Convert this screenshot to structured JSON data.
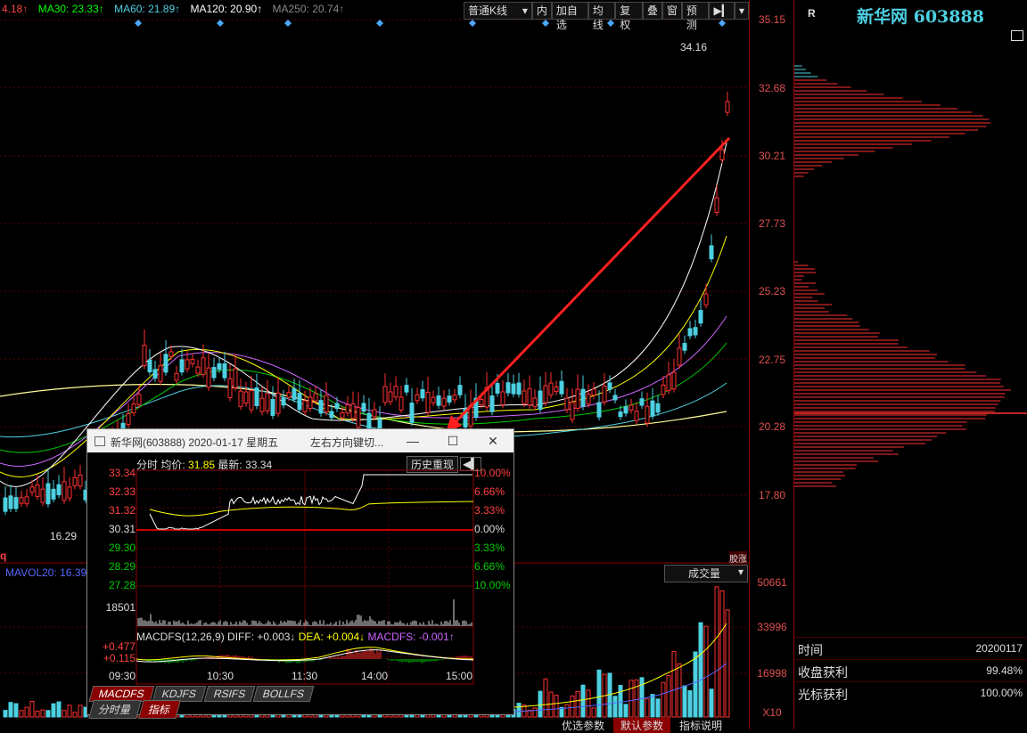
{
  "ma_line": {
    "ma_first": "4.18↑",
    "ma30": "MA30: 23.33↑",
    "ma60": "MA60: 21.89↑",
    "ma120": "MA120: 20.90↑",
    "ma250": "MA250: 20.74↑",
    "colors": {
      "ma_first": "#ff4040",
      "ma30": "#00ff00",
      "ma60": "#4dd0e1",
      "ma120": "#ffffff",
      "ma250": "#888888"
    }
  },
  "toolbar": {
    "kline_type": "普通K线",
    "buttons": [
      "内",
      "加自选",
      "均线",
      "复权",
      "叠",
      "窗",
      "预测"
    ]
  },
  "price_axis": [
    "35.15",
    "32.68",
    "30.21",
    "27.73",
    "25.23",
    "22.75",
    "20.28",
    "17.80"
  ],
  "volume_axis": [
    "50661",
    "33996",
    "16998",
    "X10"
  ],
  "high_label": "34.16",
  "low_label": "16.29",
  "fan_label": "胶涨",
  "volume": {
    "selector": "成交量",
    "mavol": "MAVOL20: 16.39",
    "indicator_char": "q"
  },
  "sidebar": {
    "r_mark": "R",
    "title": "新华网 603888",
    "stats": [
      {
        "key": "时间",
        "value": "20200117"
      },
      {
        "key": "收盘获利",
        "value": "99.48%"
      },
      {
        "key": "光标获利",
        "value": "100.00%"
      }
    ]
  },
  "popup": {
    "title": "新华网(603888)  2020-01-17 星期五",
    "subtitle": "左右方向键切...",
    "head": {
      "label": "分时",
      "avg_label": "均价:",
      "avg": "31.85",
      "last_label": "最新:",
      "last": "33.34"
    },
    "history_btn": "历史重现",
    "left_prices": [
      "33.34",
      "32.33",
      "31.32",
      "30.31",
      "29.30",
      "28.29",
      "27.28"
    ],
    "right_pcts": [
      "10.00%",
      "6.66%",
      "3.33%",
      "0.00%",
      "3.33%",
      "6.66%",
      "10.00%"
    ],
    "vol_label": "18501",
    "macd": {
      "name": "MACDFS(12,26,9)",
      "diff": "DIFF: +0.003↓",
      "dea": "DEA: +0.004↓",
      "macdfs": "MACDFS: -0.001↑",
      "hi": "+0.477",
      "mid": "+0.115"
    },
    "times": [
      "09:30",
      "10:30",
      "11:30",
      "14:00",
      "15:00"
    ],
    "tabs": [
      "MACDFS",
      "KDJFS",
      "RSIFS",
      "BOLLFS"
    ],
    "tabs2": [
      "分时量",
      "指标"
    ]
  },
  "bottom": [
    "优选参数",
    "默认参数",
    "指标说明"
  ]
}
